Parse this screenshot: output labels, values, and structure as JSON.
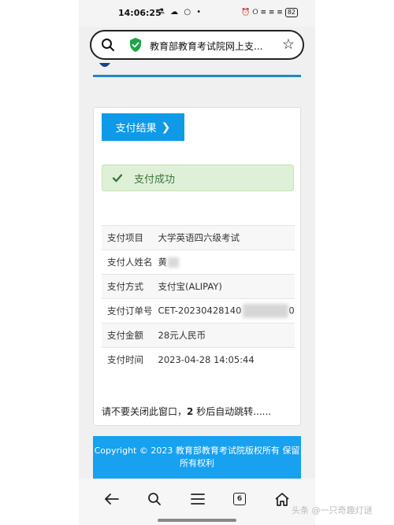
{
  "status_bar": {
    "time": "14:06:25",
    "left_icons": "⚗ ☁ ○ •",
    "right_icons": "⏰ ⭘ ≡ ≡ ≡",
    "battery": "82"
  },
  "browser": {
    "url_text": "教育部教育考试院网上支...",
    "star": "☆"
  },
  "card": {
    "result_button_label": "支付结果",
    "result_button_chevron": "❯",
    "alert_message": "支付成功",
    "rows": [
      {
        "key": "支付项目",
        "value": "大学英语四六级考试"
      },
      {
        "key": "支付人姓名",
        "value": "黄"
      },
      {
        "key": "支付方式",
        "value": "支付宝(ALIPAY)"
      },
      {
        "key": "支付订单号",
        "value": "CET-20230428140",
        "value_suffix": "0"
      },
      {
        "key": "支付金额",
        "value": "28元人民币"
      },
      {
        "key": "支付时间",
        "value": "2023-04-28 14:05:44"
      }
    ],
    "redirect_prefix": "请不要关闭此窗口，",
    "redirect_seconds": "2",
    "redirect_suffix": " 秒后自动跳转......"
  },
  "footer": {
    "copyright": "Copyright © 2023 教育部教育考试院版权所有 保留所有权利"
  },
  "navbar": {
    "tab_count": "6"
  },
  "watermark": "头条 @一只奇趣灯谜",
  "colors": {
    "accent": "#0f9ae8",
    "footer": "#17a1ef",
    "success_bg": "#dff0d8",
    "success_text": "#3c763d"
  }
}
